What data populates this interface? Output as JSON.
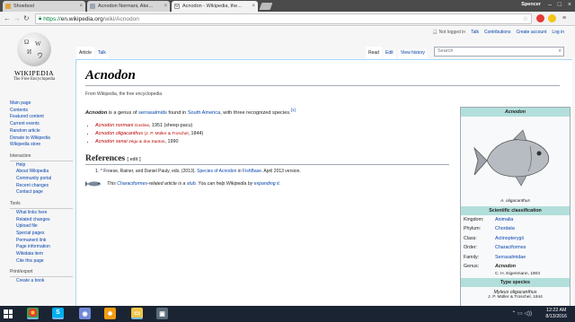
{
  "browser": {
    "tabs": [
      {
        "title": "Shoeboxl",
        "favicon_color": "#e2a33d"
      },
      {
        "title": "Acnodon Normani, Ake…",
        "favicon_color": "#9aa6b4"
      },
      {
        "title": "Acnodon - Wikipedia, the…",
        "favicon_color": "#ffffff",
        "active": true
      }
    ],
    "profile": "Spencer",
    "url_scheme": "https://",
    "url_host": "en.wikipedia.org",
    "url_path": "/wiki/Acnodon",
    "colors": {
      "tabstrip": "#4b4b4b",
      "secure": "#0b8043"
    }
  },
  "wiki": {
    "logo_wordmark": "WIKIPEDIA",
    "logo_tagline": "The Free Encyclopedia",
    "nav": [
      "Main page",
      "Contents",
      "Featured content",
      "Current events",
      "Random article",
      "Donate to Wikipedia",
      "Wikipedia store"
    ],
    "interaction": {
      "heading": "Interaction",
      "items": [
        "Help",
        "About Wikipedia",
        "Community portal",
        "Recent changes",
        "Contact page"
      ]
    },
    "tools": {
      "heading": "Tools",
      "items": [
        "What links here",
        "Related changes",
        "Upload file",
        "Special pages",
        "Permanent link",
        "Page information",
        "Wikidata item",
        "Cite this page"
      ]
    },
    "print": {
      "heading": "Print/export",
      "items": [
        "Create a book"
      ]
    },
    "personal": {
      "not_logged": "Not logged in",
      "talk": "Talk",
      "contributions": "Contributions",
      "create": "Create account",
      "login": "Log in"
    },
    "tabs": {
      "article": "Article",
      "talk": "Talk",
      "read": "Read",
      "edit": "Edit",
      "history": "View history"
    },
    "search_placeholder": "Search",
    "title": "Acnodon",
    "from": "From Wikipedia, the free encyclopedia",
    "lead": {
      "name": "Acnodon",
      "t1": " is a genus of ",
      "link1": "serrasalmids",
      "t2": " found in ",
      "link2": "South America",
      "t3": ", with three recognized species.",
      "ref": "[1]"
    },
    "species": [
      {
        "name": "Acnodon normani",
        "author": "Gosline",
        "year": ", 1951 (sheep-pacu)"
      },
      {
        "name": "Acnodon oligacanthus",
        "author": "(J. P. Müller & Troschel",
        "year": ", 1844)"
      },
      {
        "name": "Acnodon senai",
        "author": "Jégu & dos Santos",
        "year": ", 1990"
      }
    ],
    "refs_heading": "References",
    "refs_edit": "[ edit ]",
    "ref1": {
      "num": "1.",
      "caret": "^",
      "text": " Froese, Rainer, and Daniel Pauly, eds. (2013). ",
      "link": "Species of Acnodon",
      "mid": " in ",
      "link2": "FishBase",
      "end": ". April 2013 version."
    },
    "stub": {
      "t1": "This ",
      "link1": "Characiformes",
      "t2": "-related article is a ",
      "link2": "stub",
      "t3": ". You can help Wikipedia by ",
      "link3": "expanding it",
      "t4": "."
    },
    "infobox": {
      "name": "Acnodon",
      "caption": "A. oligacanthus",
      "sci_heading": "Scientific classification",
      "rows": [
        {
          "k": "Kingdom:",
          "v": "Animalia"
        },
        {
          "k": "Phylum:",
          "v": "Chordata"
        },
        {
          "k": "Class:",
          "v": "Actinopterygii"
        },
        {
          "k": "Order:",
          "v": "Characiformes"
        },
        {
          "k": "Family:",
          "v": "Serrasalmidae"
        },
        {
          "k": "Genus:",
          "v": "Acnodon"
        }
      ],
      "genus_author": "C. H. Eigenmann, 1903",
      "type_heading": "Type species",
      "type_name": "Myleus oligacanthus",
      "type_author": "J. P. Müller & Troschel, 1844"
    }
  },
  "taskbar": {
    "time": "12:22 AM",
    "date": "8/13/2016"
  }
}
